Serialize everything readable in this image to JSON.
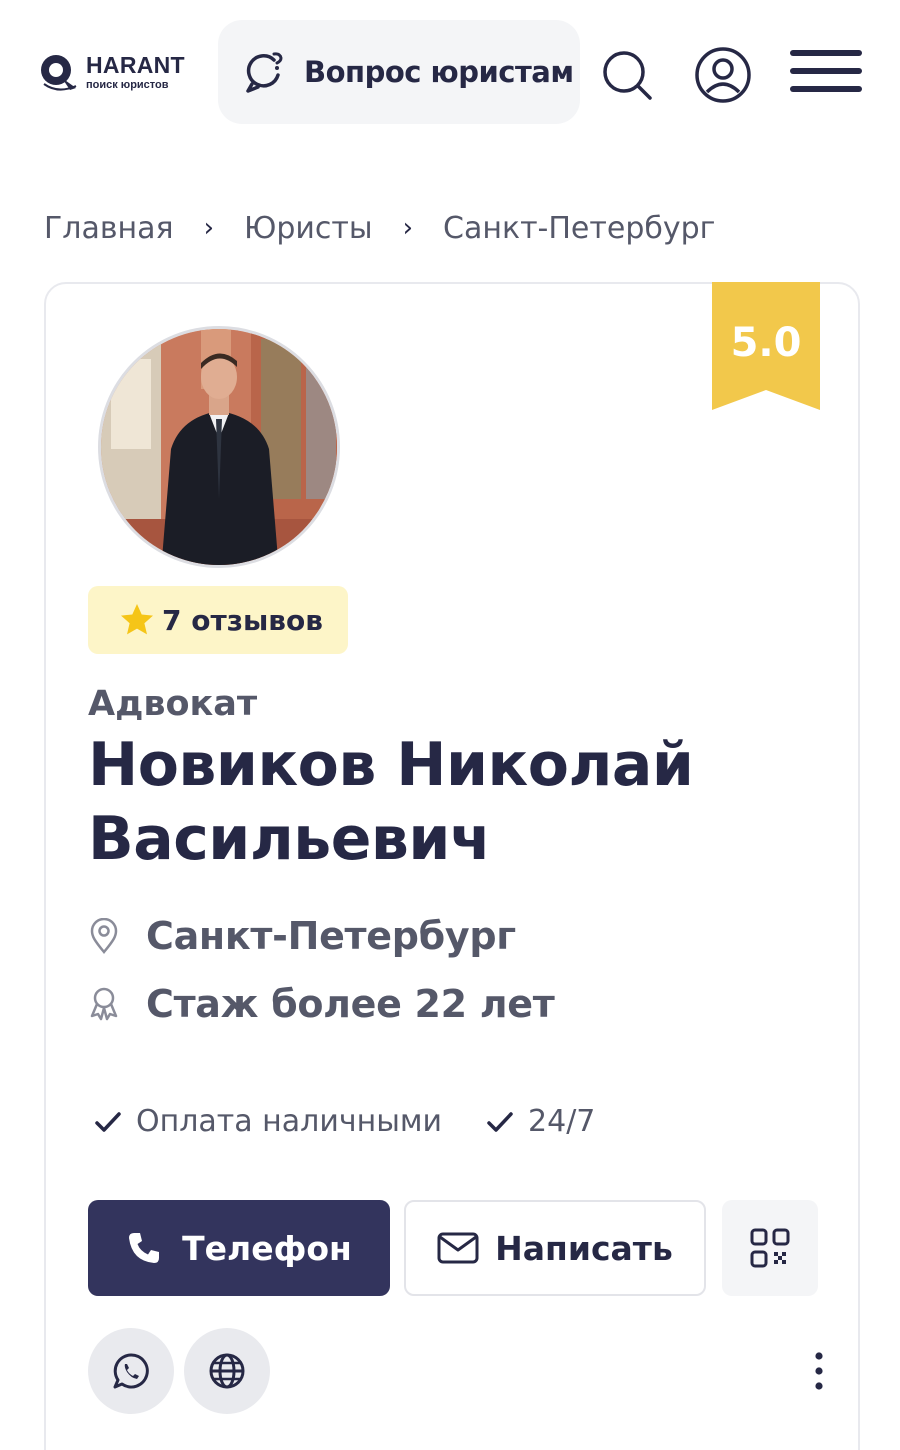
{
  "header": {
    "logo": {
      "name": "HARANT",
      "subtitle": "поиск юристов"
    },
    "ask_button_label": "Вопрос юристам",
    "icons": [
      "search-icon",
      "user-icon",
      "menu-icon"
    ]
  },
  "breadcrumb": {
    "items": [
      "Главная",
      "Юристы",
      "Санкт-Петербург"
    ],
    "separator": "›"
  },
  "profile": {
    "rating": "5.0",
    "reviews_label": "7 отзывов",
    "role": "Адвокат",
    "name": "Новиков Николай Васильевич",
    "city": "Санкт-Петербург",
    "experience": "Стаж более 22 лет",
    "features": [
      "Оплата наличными",
      "24/7"
    ]
  },
  "actions": {
    "phone_label": "Телефон",
    "write_label": "Написать",
    "icons": [
      "phone-icon",
      "mail-icon",
      "qr-code-icon",
      "whatsapp-icon",
      "globe-icon",
      "more-vertical-icon"
    ]
  },
  "colors": {
    "primary": "#33345d",
    "text": "#262845",
    "muted": "#555869",
    "rating_ribbon": "#f2c84b",
    "reviews_badge_bg": "#fdf5c8",
    "star": "#f5c518",
    "light_bg": "#f4f5f7"
  }
}
